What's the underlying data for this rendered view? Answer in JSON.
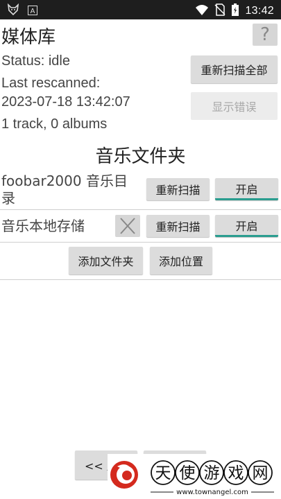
{
  "statusbar": {
    "time": "13:42",
    "left_icons": [
      "fox-app-icon",
      "text-a-icon"
    ],
    "right_icons": [
      "wifi-icon",
      "no-sim-icon",
      "battery-charging-icon"
    ]
  },
  "header": {
    "title": "媒体库",
    "help_label": "?"
  },
  "status": {
    "status_line": "Status: idle",
    "last_rescanned_label": "Last rescanned:",
    "last_rescanned_value": "2023-07-18 13:42:07",
    "counts": "1 track, 0 albums"
  },
  "actions": {
    "rescan_all": "重新扫描全部",
    "show_errors": "显示错误"
  },
  "folders": {
    "heading": "音乐文件夹",
    "items": [
      {
        "name": "foobar2000 音乐目录",
        "name_line1": "foobar2000 音乐目",
        "name_line2": "录",
        "rescan": "重新扫描",
        "toggle": "开启",
        "removable": false
      },
      {
        "name": "音乐本地存储",
        "rescan": "重新扫描",
        "toggle": "开启",
        "removable": true
      }
    ],
    "add_folder": "添加文件夹",
    "add_location": "添加位置"
  },
  "footer": {
    "back_label": "<< 后"
  },
  "watermark": {
    "brand_text": "天使游戏网",
    "url": "www.townangel.com"
  },
  "colors": {
    "statusbar_bg": "#1e1e1e",
    "toggle_accent": "#2a9d8f",
    "button_bg": "#dcdcdc",
    "logo_red": "#d42a1e"
  }
}
